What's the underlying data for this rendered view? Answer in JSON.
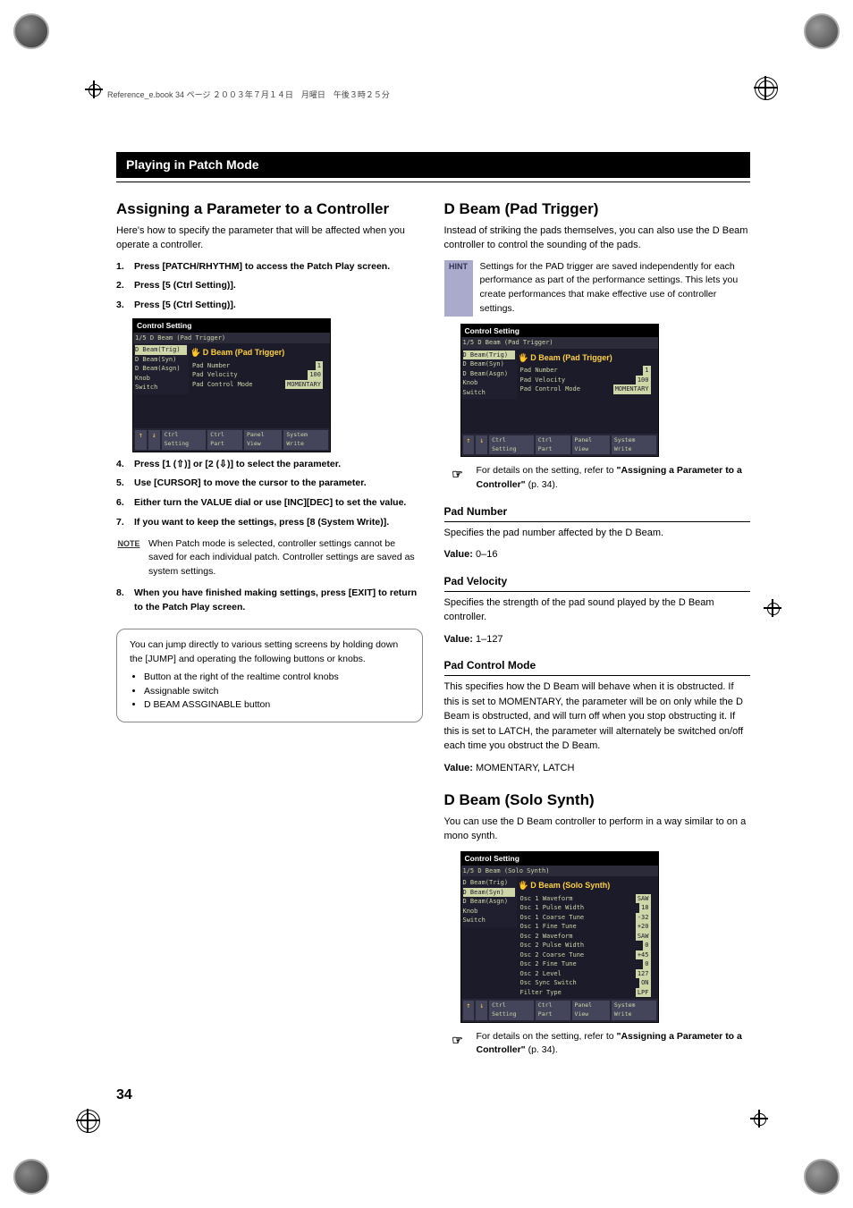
{
  "header_line": "Reference_e.book 34 ページ ２００３年７月１４日　月曜日　午後３時２５分",
  "mode_bar": "Playing in Patch Mode",
  "page_number": "34",
  "left": {
    "h1": "Assigning a Parameter to a Controller",
    "intro": "Here's how to specify the parameter that will be affected when you operate a controller.",
    "steps_a": [
      "Press [PATCH/RHYTHM] to access the Patch Play screen.",
      "Press [5 (Ctrl Setting)].",
      "Press [5 (Ctrl Setting)]."
    ],
    "shot1": {
      "title": "Control Setting",
      "tab": "D Beam (Pad Trigger)",
      "side": [
        "D Beam(Trig)",
        "D Beam(Syn)",
        "D Beam(Asgn)",
        "Knob",
        "Switch"
      ],
      "side_sel": 0,
      "panel": "D Beam (Pad Trigger)",
      "rows": [
        [
          "Pad Number",
          "1"
        ],
        [
          "Pad Velocity",
          "100"
        ],
        [
          "Pad Control Mode",
          "MOMENTARY"
        ]
      ],
      "buttons": [
        "↑",
        "↓",
        "Ctrl Setting",
        "Ctrl Part",
        "Panel View",
        "System Write"
      ]
    },
    "steps_b": [
      "Press [1 (⇧)] or [2 (⇩)] to select the parameter.",
      "Use [CURSOR] to move the cursor to the parameter.",
      "Either turn the VALUE dial or use [INC][DEC] to set the value.",
      "If you want to keep the settings, press [8 (System Write)]."
    ],
    "note_label": "NOTE",
    "note": "When Patch mode is selected, controller settings cannot be saved for each individual patch. Controller settings are saved as system settings.",
    "steps_c": [
      "When you have finished making settings, press [EXIT] to return to the Patch Play screen."
    ],
    "tip_intro": "You can jump directly to various setting screens by holding down the [JUMP] and operating the following buttons or knobs.",
    "tip_items": [
      "Button at the right of the realtime control knobs",
      "Assignable switch",
      "D BEAM ASSGINABLE button"
    ]
  },
  "right": {
    "h1a": "D Beam (Pad Trigger)",
    "p1": "Instead of striking the pads themselves, you can also use the D Beam controller to control the sounding of the pads.",
    "hint_label": "HINT",
    "hint": "Settings for the PAD trigger are saved independently for each performance as part of the performance settings. This lets you create performances that make effective use of controller settings.",
    "shot2": {
      "title": "Control Setting",
      "tab": "D Beam (Pad Trigger)",
      "side": [
        "D Beam(Trig)",
        "D Beam(Syn)",
        "D Beam(Asgn)",
        "Knob",
        "Switch"
      ],
      "side_sel": 0,
      "panel": "D Beam (Pad Trigger)",
      "rows": [
        [
          "Pad Number",
          "1"
        ],
        [
          "Pad Velocity",
          "100"
        ],
        [
          "Pad Control Mode",
          "MOMENTARY"
        ]
      ],
      "buttons": [
        "↑",
        "↓",
        "Ctrl Setting",
        "Ctrl Part",
        "Panel View",
        "System Write"
      ]
    },
    "ref1a": "For details on the setting, refer to ",
    "ref1b": "\"Assigning a Parameter to a Controller\"",
    "ref1c": " (p. 34).",
    "param1_h": "Pad Number",
    "param1_p": "Specifies the pad number affected by the D Beam.",
    "param1_v_label": "Value:",
    "param1_v": " 0–16",
    "param2_h": "Pad Velocity",
    "param2_p": "Specifies the strength of the pad sound played by the D Beam controller.",
    "param2_v_label": "Value:",
    "param2_v": " 1–127",
    "param3_h": "Pad Control Mode",
    "param3_p": "This specifies how the D Beam will behave when it is obstructed. If this is set to MOMENTARY, the parameter will be on only while the D Beam is obstructed, and will turn off when you stop obstructing it. If this is set to LATCH, the parameter will alternately be switched on/off each time you obstruct the D Beam.",
    "param3_v_label": "Value:",
    "param3_v": " MOMENTARY, LATCH",
    "h1b": "D Beam (Solo Synth)",
    "p2": "You can use the D Beam controller to perform in a way similar to on a mono synth.",
    "shot3": {
      "title": "Control Setting",
      "tab": "D Beam (Solo Synth)",
      "side": [
        "D Beam(Trig)",
        "D Beam(Syn)",
        "D Beam(Asgn)",
        "Knob",
        "Switch"
      ],
      "side_sel": 1,
      "panel": "D Beam (Solo Synth)",
      "rows": [
        [
          "Osc 1 Waveform",
          "SAW"
        ],
        [
          "Osc 1 Pulse Width",
          "18"
        ],
        [
          "Osc 1 Coarse Tune",
          "-32"
        ],
        [
          "Osc 1 Fine Tune",
          "+20"
        ],
        [
          "Osc 2 Waveform",
          "SAW"
        ],
        [
          "Osc 2 Pulse Width",
          "0"
        ],
        [
          "Osc 2 Coarse Tune",
          "+45"
        ],
        [
          "Osc 2 Fine Tune",
          "0"
        ],
        [
          "Osc 2 Level",
          "127"
        ],
        [
          "Osc Sync Switch",
          "ON"
        ],
        [
          "Filter Type",
          "LPF"
        ]
      ],
      "buttons": [
        "↑",
        "↓",
        "Ctrl Setting",
        "Ctrl Part",
        "Panel View",
        "System Write"
      ]
    },
    "ref2a": "For details on the setting, refer to ",
    "ref2b": "\"Assigning a Parameter to a Controller\"",
    "ref2c": " (p. 34)."
  }
}
